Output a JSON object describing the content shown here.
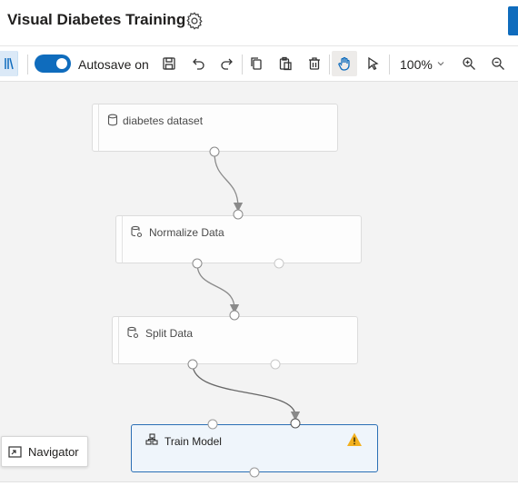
{
  "header": {
    "title": "Visual Diabetes Training",
    "settings_icon": "gear-icon",
    "accent_color": "#0f6cbd"
  },
  "toolbar": {
    "autosave_label": "Autosave on",
    "autosave_enabled": true,
    "zoom_level": "100%",
    "tools": [
      "library-icon",
      "save-icon",
      "undo-icon",
      "redo-icon",
      "copy-icon",
      "paste-icon",
      "delete-icon",
      "pan-icon",
      "select-icon",
      "zoom-in-icon",
      "zoom-out-icon"
    ],
    "active_tool": "pan-icon"
  },
  "canvas": {
    "nodes": [
      {
        "label": "diabetes dataset",
        "icon": "dataset-icon"
      },
      {
        "label": "Normalize Data",
        "icon": "module-icon"
      },
      {
        "label": "Split Data",
        "icon": "module-icon"
      },
      {
        "label": "Train Model",
        "icon": "train-model-icon",
        "status": "warning-icon",
        "selected": true
      }
    ],
    "warning_color": "#f2b01e"
  },
  "navigator": {
    "label": "Navigator",
    "icon": "navigator-icon"
  }
}
